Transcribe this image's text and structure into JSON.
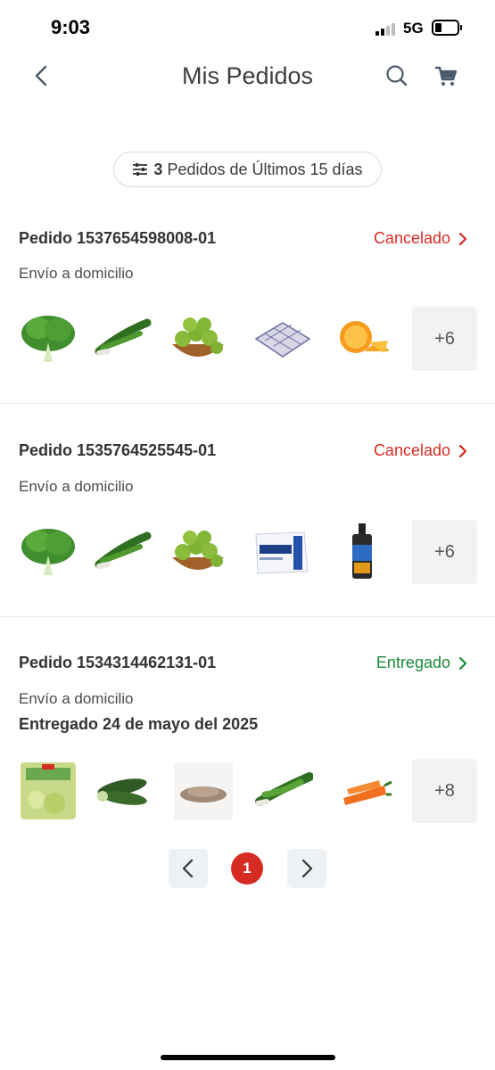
{
  "status_bar": {
    "time": "9:03",
    "network": "5G"
  },
  "header": {
    "title": "Mis Pedidos"
  },
  "filter": {
    "count": "3",
    "label": "Pedidos de Últimos 15 días"
  },
  "orders": [
    {
      "id": "Pedido 1537654598008-01",
      "status": "Cancelado",
      "shipping": "Envío a domicilio",
      "more": "+6",
      "items": [
        "lettuce",
        "green-onions",
        "limes-basket",
        "eggs-carton",
        "oranges"
      ]
    },
    {
      "id": "Pedido 1535764525545-01",
      "status": "Cancelado",
      "shipping": "Envío a domicilio",
      "more": "+6",
      "items": [
        "lettuce",
        "green-onions",
        "limes-basket",
        "michelob-ultra-pack",
        "bottle"
      ]
    },
    {
      "id": "Pedido 1534314462131-01",
      "status": "Entregado",
      "shipping": "Envío a domicilio",
      "delivered": "Entregado 24 de mayo del 2025",
      "more": "+8",
      "items": [
        "salad-bag",
        "cucumbers",
        "ground-spice",
        "green-onions",
        "carrots"
      ]
    }
  ],
  "pagination": {
    "current": "1"
  },
  "colors": {
    "cancel": "#d62b23",
    "delivered": "#1a8a38",
    "accent": "#d62b23"
  }
}
